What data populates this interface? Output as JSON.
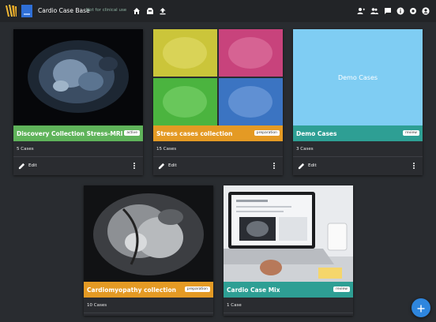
{
  "header": {
    "title": "Cardio Case Base",
    "disclaimer": "Not for clinical use",
    "nav_icons": [
      "home-icon",
      "inbox-icon",
      "upload-icon"
    ],
    "action_icons": [
      "add-user-icon",
      "group-icon",
      "chat-icon",
      "info-icon",
      "settings-icon",
      "account-icon"
    ]
  },
  "colors": {
    "background": "#292c30",
    "topbar": "#222427",
    "green_band": "#5fb35a",
    "orange_band": "#e49a24",
    "teal_band": "#2e9f94",
    "demo_tile": "#7fcdf3",
    "fab": "#2e86de"
  },
  "cards": [
    {
      "title": "Discovery Collection Stress-MRI",
      "badge": "active",
      "count": "5 Cases",
      "edit_label": "Edit",
      "band_color": "#5fb35a"
    },
    {
      "title": "Stress cases collection",
      "badge": "preparation",
      "count": "15 Cases",
      "edit_label": "Edit",
      "band_color": "#e49a24"
    },
    {
      "title": "Demo Cases",
      "image_text": "Demo Cases",
      "badge": "review",
      "count": "3 Cases",
      "edit_label": "Edit",
      "band_color": "#2e9f94"
    },
    {
      "title": "Cardiomyopathy collection",
      "badge": "preparation",
      "count": "10 Cases",
      "band_color": "#e49a24"
    },
    {
      "title": "Cardio Case Mix",
      "badge": "review",
      "count": "1 Case",
      "band_color": "#2e9f94"
    }
  ],
  "fab_icon": "plus-icon"
}
